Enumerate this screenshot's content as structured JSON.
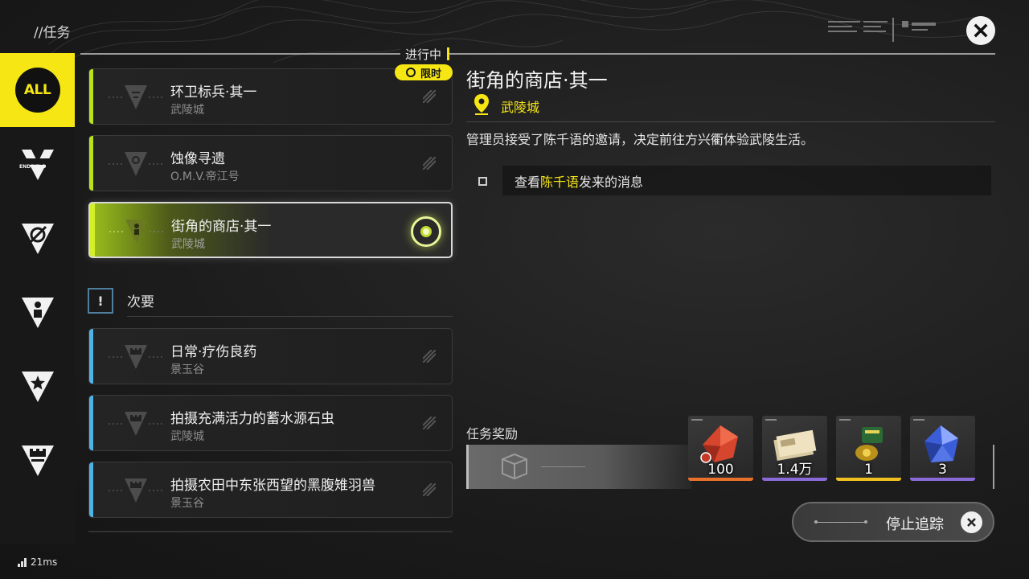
{
  "header": {
    "breadcrumb": "//任务",
    "close_icon": "close-icon"
  },
  "filters": [
    {
      "id": "all",
      "label": "ALL",
      "icon": "all-badge",
      "active": true
    },
    {
      "id": "endfield",
      "label": "ENDFIELD",
      "icon": "endfield-v-icon",
      "active": false
    },
    {
      "id": "factory",
      "label": "",
      "icon": "slashed-circle-triangle-icon",
      "active": false
    },
    {
      "id": "character",
      "label": "",
      "icon": "person-triangle-icon",
      "active": false
    },
    {
      "id": "special",
      "label": "",
      "icon": "star-triangle-icon",
      "active": false
    },
    {
      "id": "daily",
      "label": "",
      "icon": "castle-triangle-icon",
      "active": false
    }
  ],
  "in_progress": {
    "label": "进行中",
    "limit_badge": "限时",
    "quests": [
      {
        "title": "环卫标兵·其一",
        "location": "武陵城",
        "type": "main",
        "selected": false
      },
      {
        "title": "蚀像寻遗",
        "location": "O.M.V.帝江号",
        "type": "main",
        "selected": false
      },
      {
        "title": "街角的商店·其一",
        "location": "武陵城",
        "type": "main",
        "selected": true
      }
    ]
  },
  "secondary": {
    "icon_text": "!",
    "label": "次要",
    "quests": [
      {
        "title": "日常·疗伤良药",
        "location": "景玉谷",
        "type": "side"
      },
      {
        "title": "拍摄充满活力的蓄水源石虫",
        "location": "武陵城",
        "type": "side"
      },
      {
        "title": "拍摄农田中东张西望的黑腹雉羽兽",
        "location": "景玉谷",
        "type": "side"
      }
    ]
  },
  "detail": {
    "title": "街角的商店·其一",
    "location": "武陵城",
    "description": "管理员接受了陈千语的邀请，决定前往方兴衢体验武陵生活。",
    "objective_prefix": "查看",
    "objective_highlight": "陈千语",
    "objective_suffix": "发来的消息"
  },
  "rewards": {
    "label": "任务奖励",
    "items": [
      {
        "name": "red-crystal",
        "qty": "100",
        "rarity_color": "#e8702a"
      },
      {
        "name": "cash-stack",
        "qty": "1.4万",
        "rarity_color": "#8a6ad8"
      },
      {
        "name": "gold-device",
        "qty": "1",
        "rarity_color": "#f0c020"
      },
      {
        "name": "blue-crystal",
        "qty": "3",
        "rarity_color": "#8a6ad8"
      }
    ]
  },
  "stop_tracking": {
    "label": "停止追踪"
  },
  "footer": {
    "ping": "21ms"
  },
  "colors": {
    "accent": "#f5e614",
    "main_quest": "#b7e21c",
    "side_quest": "#4fb3e8"
  }
}
